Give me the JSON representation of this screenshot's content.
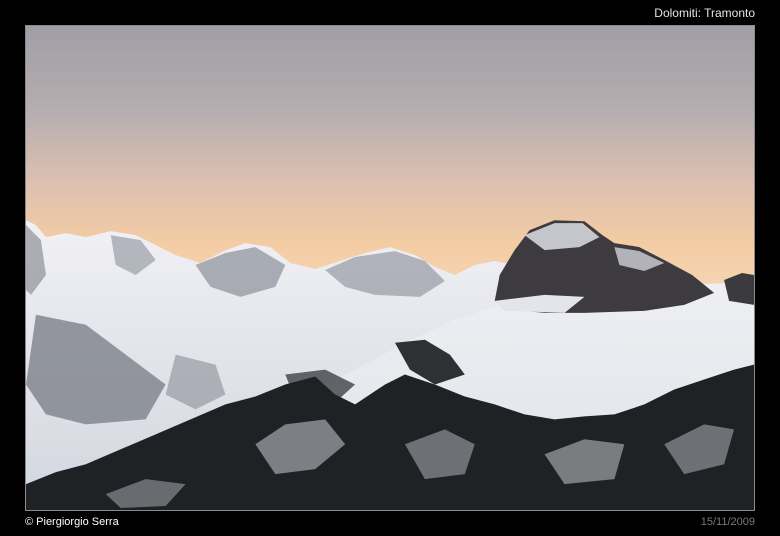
{
  "header": {
    "title": "Dolomiti: Tramonto"
  },
  "footer": {
    "credit": "© Piergiorgio Serra",
    "date": "15/11/2009"
  },
  "photo": {
    "subject": "snow-covered mountain range at sunset",
    "colors": {
      "sky_top": "#a6a4ab",
      "sky_glow": "#f7cfa3",
      "snow": "#e9ebf0",
      "rock": "#3a3a3e",
      "forest": "#1c1f22"
    }
  }
}
